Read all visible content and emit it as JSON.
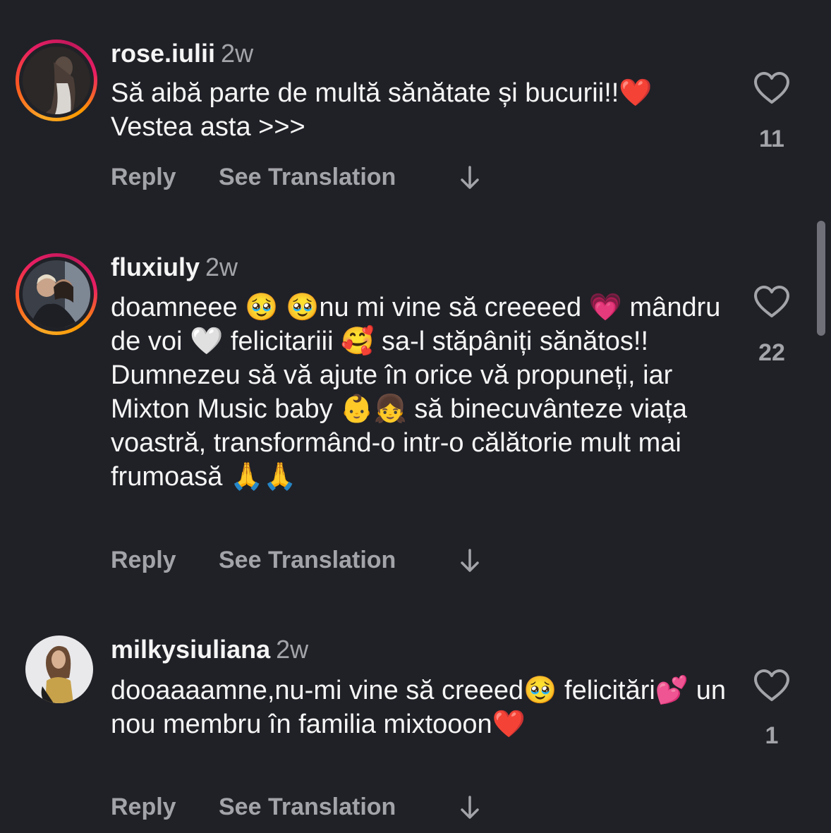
{
  "comments": [
    {
      "username": "rose.iulii",
      "time": "2w",
      "text": "Să aibă parte de multă sănătate și bucurii!!❤️ Vestea asta >>>",
      "likes": "11",
      "reply_label": "Reply",
      "translate_label": "See Translation"
    },
    {
      "username": "fluxiuly",
      "time": "2w",
      "text": "doamneee 🥹 🥹nu mi vine să creeeed 💗 mândru de voi 🤍 felicitariii 🥰 sa-l stăpâniți sănătos!! Dumnezeu să vă ajute în orice vă propuneți, iar Mixton Music baby 👶👧 să binecuvânteze viața voastră, transformând-o intr-o călătorie mult mai frumoasă 🙏🙏",
      "likes": "22",
      "reply_label": "Reply",
      "translate_label": "See Translation"
    },
    {
      "username": "milkysiuliana",
      "time": "2w",
      "text": "dooaaaamne,nu-mi vine să creeed🥹 felicitări💕 un nou membru în familia mixtooon❤️",
      "likes": "1",
      "reply_label": "Reply",
      "translate_label": "See Translation"
    }
  ],
  "icons": {
    "like": "heart-outline-icon",
    "more_replies": "arrow-down-icon"
  },
  "colors": {
    "background": "#202127",
    "text": "#f5f5f5",
    "secondary": "#a3a4aa"
  }
}
